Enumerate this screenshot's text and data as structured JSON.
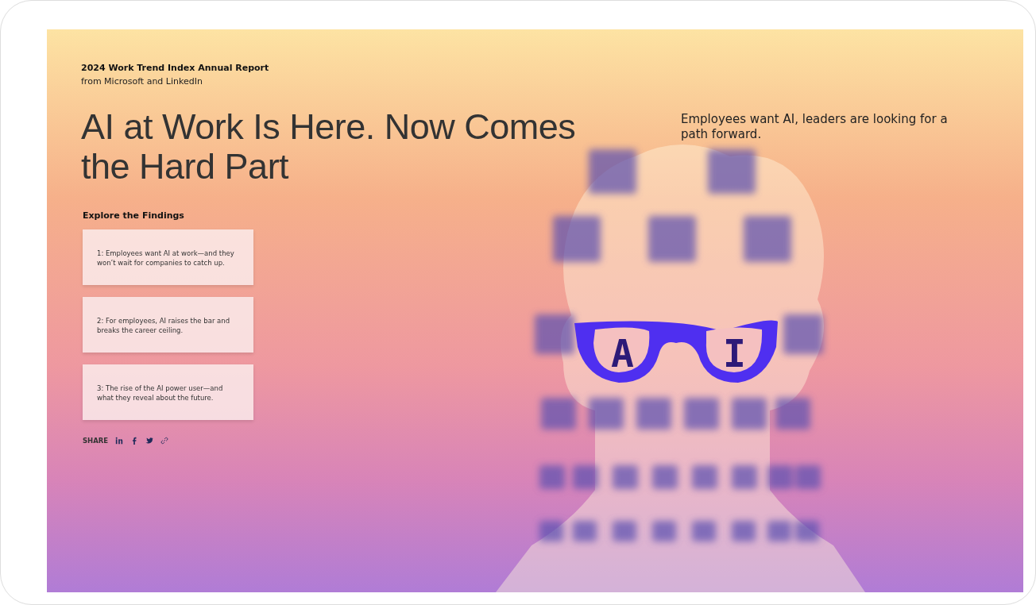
{
  "report": {
    "title": "2024 Work Trend Index Annual Report",
    "byline": "from Microsoft and LinkedIn"
  },
  "headline": "AI at Work Is Here. Now Comes the Hard Part",
  "subheadline": "Employees want AI, leaders are looking for a path forward.",
  "findings": {
    "heading": "Explore the Findings",
    "items": [
      {
        "text": "1: Employees want AI at work—and they won’t wait for companies to catch up."
      },
      {
        "text": "2: For employees, AI raises the bar and breaks the career ceiling."
      },
      {
        "text": "3: The rise of the AI power user—and what they reveal about the future."
      }
    ]
  },
  "share": {
    "label": "SHARE",
    "links": [
      {
        "kind": "linkedin"
      },
      {
        "kind": "facebook"
      },
      {
        "kind": "twitter"
      },
      {
        "kind": "link"
      }
    ]
  },
  "illustration": {
    "glasses_letters": [
      "A",
      "I"
    ]
  }
}
